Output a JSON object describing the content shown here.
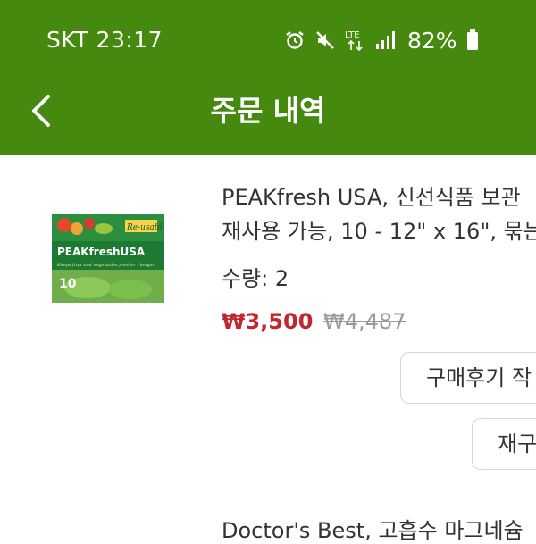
{
  "status_bar": {
    "carrier_time": "SKT 23:17",
    "battery": "82%",
    "icons": [
      "alarm-icon",
      "mute-icon",
      "lte-icon",
      "signal-icon",
      "battery-icon"
    ]
  },
  "header": {
    "title": "주문 내역",
    "back_icon": "back-chevron-icon",
    "bg_color": "#458a0e"
  },
  "order": {
    "product_name_line1": "PEAKfresh USA, 신선식품 보관",
    "product_name_line2": "재사용 가능, 10 - 12\" x 16\", 묶는",
    "quantity": "수량: 2",
    "price": "₩3,500",
    "original_price": "₩4,487",
    "thumbnail": {
      "brand": "PEAKfreshUSA",
      "tag": "Re-usable",
      "tagline": "Keeps fruit and vegetables fresher - longer",
      "count": "10"
    },
    "buttons": {
      "review": "구매후기 작",
      "reorder": "재구"
    }
  },
  "next_order": {
    "product_name": "Doctor's Best, 고흡수 마그네슘"
  }
}
